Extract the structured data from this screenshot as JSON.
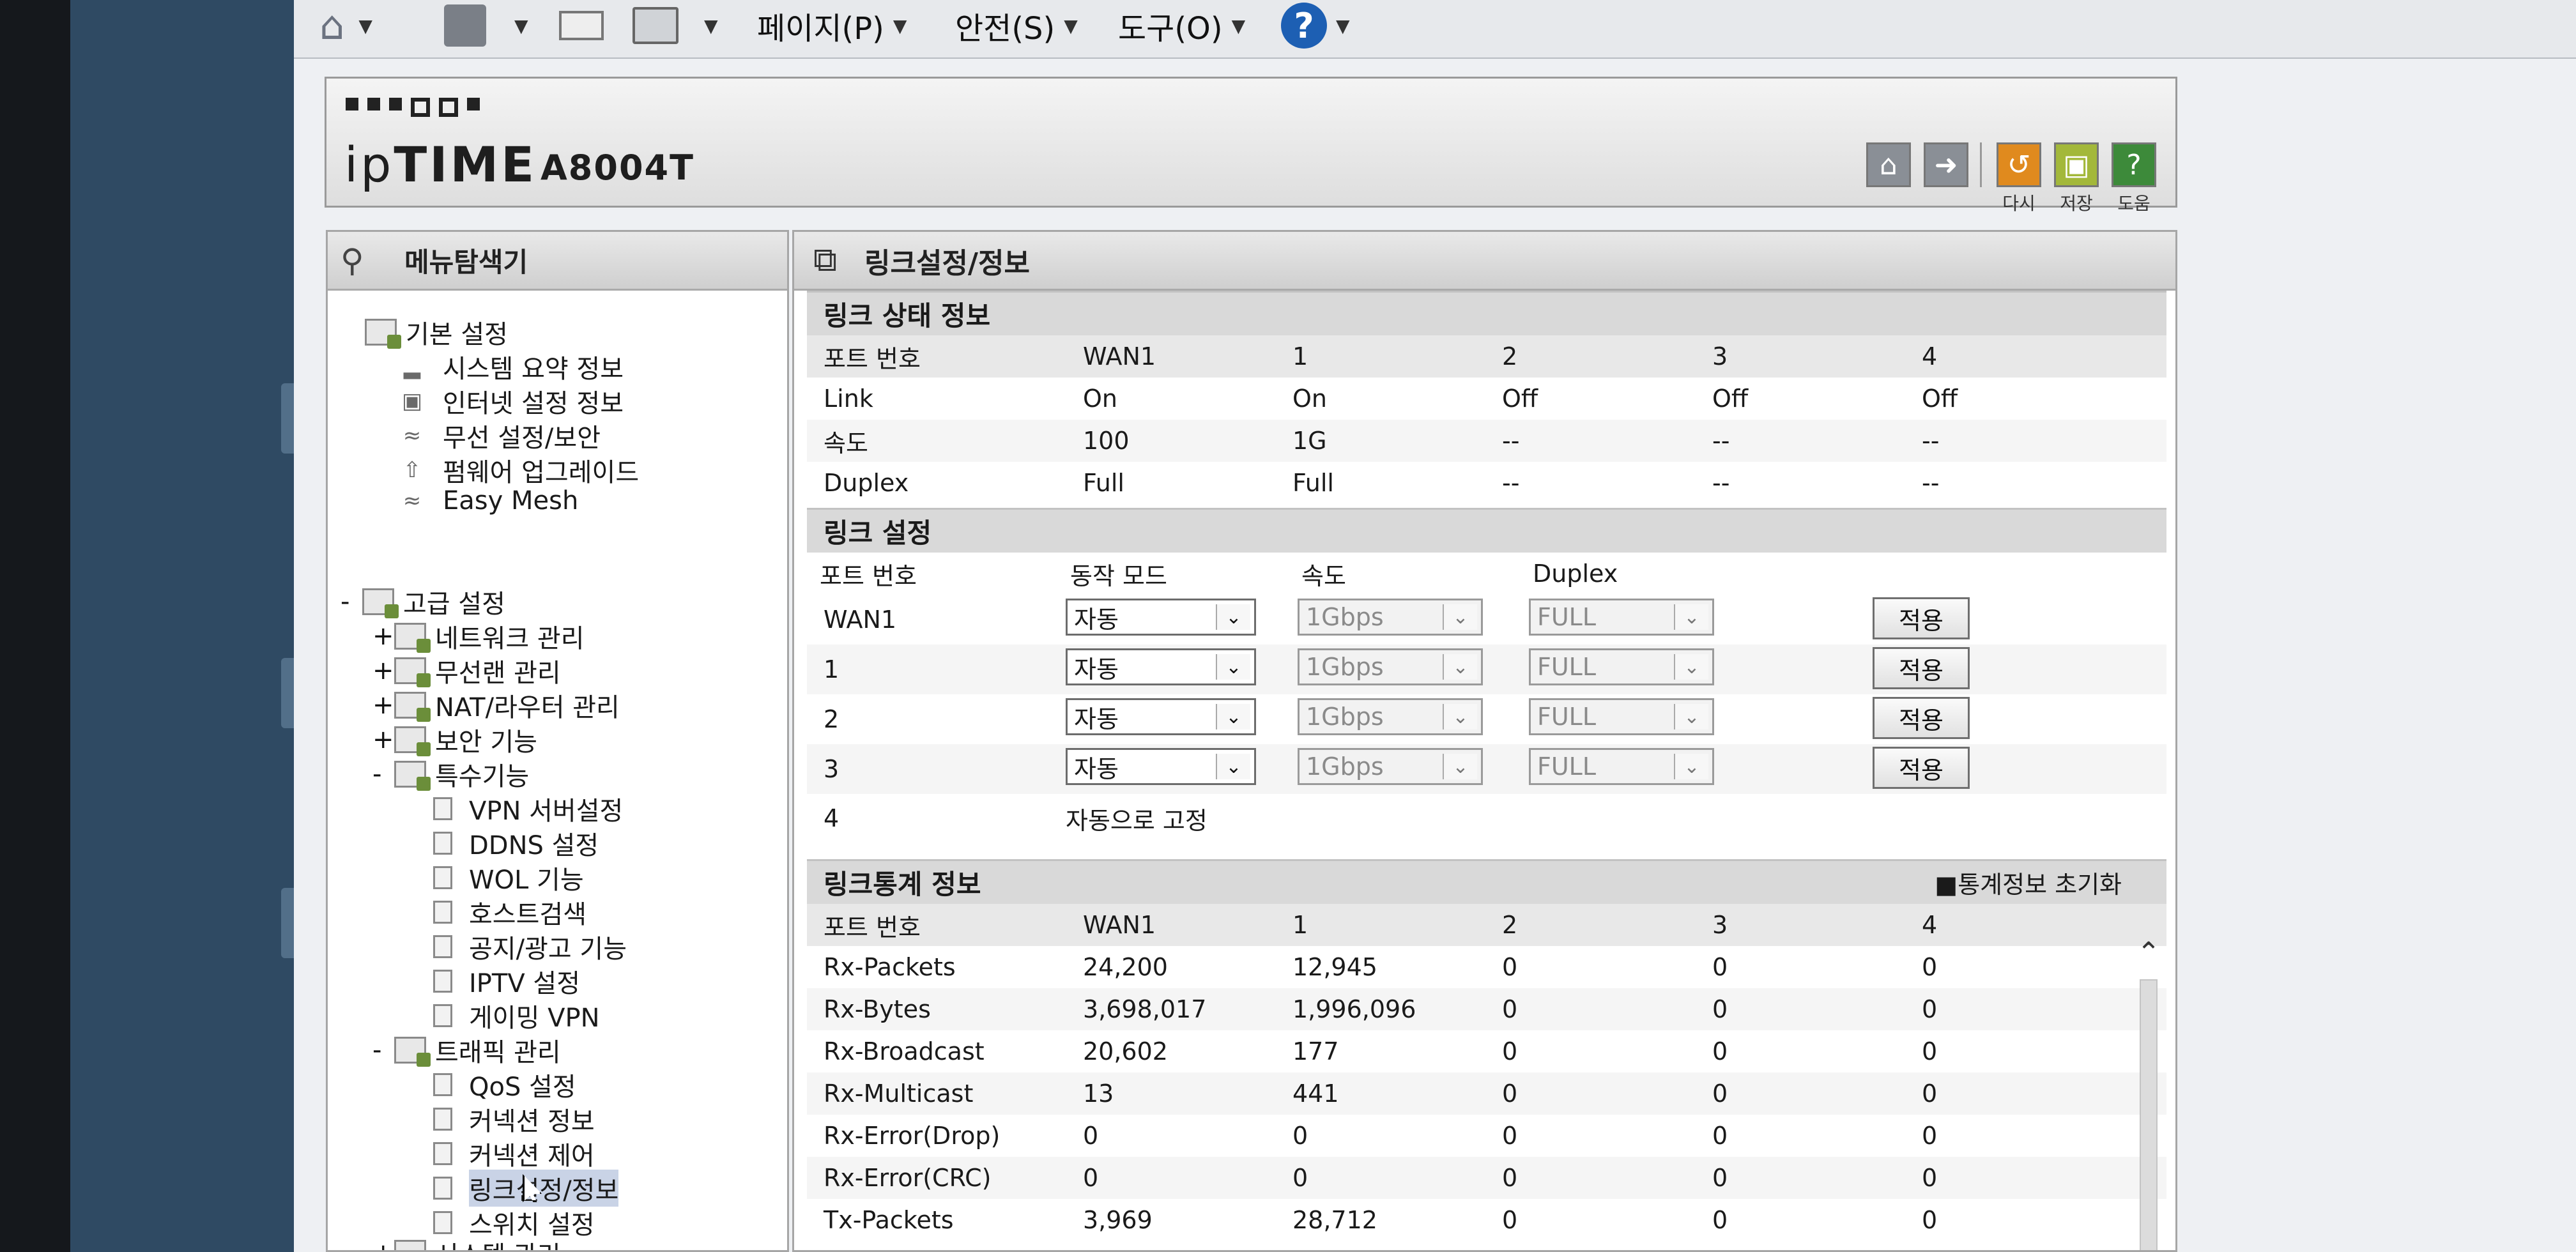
{
  "browser_toolbar": {
    "menus": [
      "페이지(P)",
      "안전(S)",
      "도구(O)"
    ],
    "help_symbol": "?",
    "icons": [
      "home-icon",
      "rss-feed-icon",
      "mail-icon",
      "print-icon",
      "help-icon"
    ]
  },
  "header": {
    "logo_prefix": "ip",
    "logo_bold": "TIME",
    "model": "A8004T",
    "buttons": [
      {
        "name": "home",
        "icon": "home-icon",
        "label": ""
      },
      {
        "name": "logout",
        "icon": "logout-icon",
        "label": ""
      },
      {
        "name": "restart",
        "icon": "restart-icon",
        "label": "다시"
      },
      {
        "name": "save",
        "icon": "save-icon",
        "label": "저장"
      },
      {
        "name": "help",
        "icon": "help-icon",
        "label": "도움"
      }
    ]
  },
  "menu": {
    "title": "메뉴탐색기",
    "basic": {
      "label": "기본 설정",
      "items": [
        "시스템 요약 정보",
        "인터넷 설정 정보",
        "무선 설정/보안",
        "펌웨어 업그레이드",
        "Easy Mesh"
      ]
    },
    "advanced": {
      "toggle": "-",
      "label": "고급 설정",
      "groups": [
        {
          "toggle": "+",
          "label": "네트워크 관리"
        },
        {
          "toggle": "+",
          "label": "무선랜 관리"
        },
        {
          "toggle": "+",
          "label": "NAT/라우터 관리"
        },
        {
          "toggle": "+",
          "label": "보안 기능"
        },
        {
          "toggle": "-",
          "label": "특수기능"
        }
      ],
      "special_items": [
        "VPN 서버설정",
        "DDNS 설정",
        "WOL 기능",
        "호스트검색",
        "공지/광고 기능",
        "IPTV 설정",
        "게이밍 VPN"
      ],
      "traffic": {
        "toggle": "-",
        "label": "트래픽 관리"
      },
      "traffic_items": [
        "QoS 설정",
        "커넥션 정보",
        "커넥션 제어",
        "링크설정/정보",
        "스위치 설정"
      ],
      "system": {
        "toggle": "+",
        "label": "시스템 관리"
      }
    }
  },
  "page": {
    "title": "링크설정/정보",
    "status": {
      "section_title": "링크 상태 정보",
      "headers": [
        "포트 번호",
        "WAN1",
        "1",
        "2",
        "3",
        "4"
      ],
      "rows": [
        [
          "Link",
          "On",
          "On",
          "Off",
          "Off",
          "Off"
        ],
        [
          "속도",
          "100",
          "1G",
          "--",
          "--",
          "--"
        ],
        [
          "Duplex",
          "Full",
          "Full",
          "--",
          "--",
          "--"
        ]
      ]
    },
    "settings": {
      "section_title": "링크 설정",
      "headers": [
        "포트 번호",
        "동작 모드",
        "속도",
        "Duplex"
      ],
      "rows": [
        {
          "port": "WAN1",
          "mode": "자동",
          "speed": "1Gbps",
          "duplex": "FULL",
          "apply": "적용"
        },
        {
          "port": "1",
          "mode": "자동",
          "speed": "1Gbps",
          "duplex": "FULL",
          "apply": "적용"
        },
        {
          "port": "2",
          "mode": "자동",
          "speed": "1Gbps",
          "duplex": "FULL",
          "apply": "적용"
        },
        {
          "port": "3",
          "mode": "자동",
          "speed": "1Gbps",
          "duplex": "FULL",
          "apply": "적용"
        }
      ],
      "fixed_row": {
        "port": "4",
        "text": "자동으로 고정"
      }
    },
    "stats": {
      "section_title": "링크통계 정보",
      "reset_label": "통계정보 초기화",
      "headers": [
        "포트 번호",
        "WAN1",
        "1",
        "2",
        "3",
        "4"
      ],
      "rows": [
        [
          "Rx-Packets",
          "24,200",
          "12,945",
          "0",
          "0",
          "0"
        ],
        [
          "Rx-Bytes",
          "3,698,017",
          "1,996,096",
          "0",
          "0",
          "0"
        ],
        [
          "Rx-Broadcast",
          "20,602",
          "177",
          "0",
          "0",
          "0"
        ],
        [
          "Rx-Multicast",
          "13",
          "441",
          "0",
          "0",
          "0"
        ],
        [
          "Rx-Error(Drop)",
          "0",
          "0",
          "0",
          "0",
          "0"
        ],
        [
          "Rx-Error(CRC)",
          "0",
          "0",
          "0",
          "0",
          "0"
        ],
        [
          "Tx-Packets",
          "3,969",
          "28,712",
          "0",
          "0",
          "0"
        ]
      ]
    }
  }
}
